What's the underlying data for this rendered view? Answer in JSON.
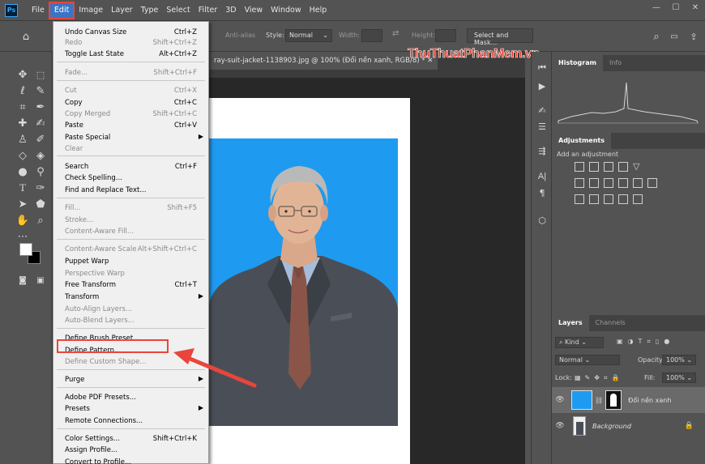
{
  "menubar": {
    "logo": "Ps",
    "items": [
      "File",
      "Edit",
      "Image",
      "Layer",
      "Type",
      "Select",
      "Filter",
      "3D",
      "View",
      "Window",
      "Help"
    ],
    "active": "Edit"
  },
  "options": {
    "anti_alias": "Anti-alias",
    "style_label": "Style:",
    "style_value": "Normal",
    "width_label": "Width:",
    "height_label": "Height:",
    "select_mask": "Select and Mask..."
  },
  "document": {
    "tab_title": "ray-suit-jacket-1138903.jpg @ 100% (Đổi nền xanh, RGB/8) *",
    "watermark": "ThuThuatPhanMem.vn",
    "photo_bg": "#1e9af0"
  },
  "edit_menu": {
    "items": [
      {
        "label": "Undo Canvas Size",
        "shortcut": "Ctrl+Z",
        "disabled": false
      },
      {
        "label": "Redo",
        "shortcut": "Shift+Ctrl+Z",
        "disabled": true
      },
      {
        "label": "Toggle Last State",
        "shortcut": "Alt+Ctrl+Z",
        "disabled": false
      },
      {
        "label": "Fade...",
        "shortcut": "Shift+Ctrl+F",
        "disabled": true
      },
      {
        "label": "Cut",
        "shortcut": "Ctrl+X",
        "disabled": true
      },
      {
        "label": "Copy",
        "shortcut": "Ctrl+C",
        "disabled": false
      },
      {
        "label": "Copy Merged",
        "shortcut": "Shift+Ctrl+C",
        "disabled": true
      },
      {
        "label": "Paste",
        "shortcut": "Ctrl+V",
        "disabled": false
      },
      {
        "label": "Paste Special",
        "shortcut": "",
        "disabled": false,
        "submenu": true
      },
      {
        "label": "Clear",
        "shortcut": "",
        "disabled": true
      },
      {
        "label": "Search",
        "shortcut": "Ctrl+F",
        "disabled": false
      },
      {
        "label": "Check Spelling...",
        "shortcut": "",
        "disabled": false
      },
      {
        "label": "Find and Replace Text...",
        "shortcut": "",
        "disabled": false
      },
      {
        "label": "Fill...",
        "shortcut": "Shift+F5",
        "disabled": true
      },
      {
        "label": "Stroke...",
        "shortcut": "",
        "disabled": true
      },
      {
        "label": "Content-Aware Fill...",
        "shortcut": "",
        "disabled": true
      },
      {
        "label": "Content-Aware Scale",
        "shortcut": "Alt+Shift+Ctrl+C",
        "disabled": true
      },
      {
        "label": "Puppet Warp",
        "shortcut": "",
        "disabled": false
      },
      {
        "label": "Perspective Warp",
        "shortcut": "",
        "disabled": true
      },
      {
        "label": "Free Transform",
        "shortcut": "Ctrl+T",
        "disabled": false
      },
      {
        "label": "Transform",
        "shortcut": "",
        "disabled": false,
        "submenu": true
      },
      {
        "label": "Auto-Align Layers...",
        "shortcut": "",
        "disabled": true
      },
      {
        "label": "Auto-Blend Layers...",
        "shortcut": "",
        "disabled": true
      },
      {
        "label": "Define Brush Preset...",
        "shortcut": "",
        "disabled": false
      },
      {
        "label": "Define Pattern...",
        "shortcut": "",
        "disabled": false
      },
      {
        "label": "Define Custom Shape...",
        "shortcut": "",
        "disabled": true
      },
      {
        "label": "Purge",
        "shortcut": "",
        "disabled": false,
        "submenu": true
      },
      {
        "label": "Adobe PDF Presets...",
        "shortcut": "",
        "disabled": false
      },
      {
        "label": "Presets",
        "shortcut": "",
        "disabled": false,
        "submenu": true
      },
      {
        "label": "Remote Connections...",
        "shortcut": "",
        "disabled": false
      },
      {
        "label": "Color Settings...",
        "shortcut": "Shift+Ctrl+K",
        "disabled": false
      },
      {
        "label": "Assign Profile...",
        "shortcut": "",
        "disabled": false
      },
      {
        "label": "Convert to Profile...",
        "shortcut": "",
        "disabled": false
      }
    ]
  },
  "panels": {
    "histogram_tab": "Histogram",
    "info_tab": "Info",
    "adjustments_tab": "Adjustments",
    "adjustments_hint": "Add an adjustment",
    "layers_tab": "Layers",
    "channels_tab": "Channels",
    "kind": "Kind",
    "blend_mode": "Normal",
    "opacity_label": "Opacity:",
    "opacity_value": "100%",
    "lock_label": "Lock:",
    "fill_label": "Fill:",
    "fill_value": "100%",
    "layers": [
      {
        "name": "Đổi nền xanh",
        "selected": true
      },
      {
        "name": "Background",
        "selected": false,
        "locked": true
      }
    ]
  }
}
